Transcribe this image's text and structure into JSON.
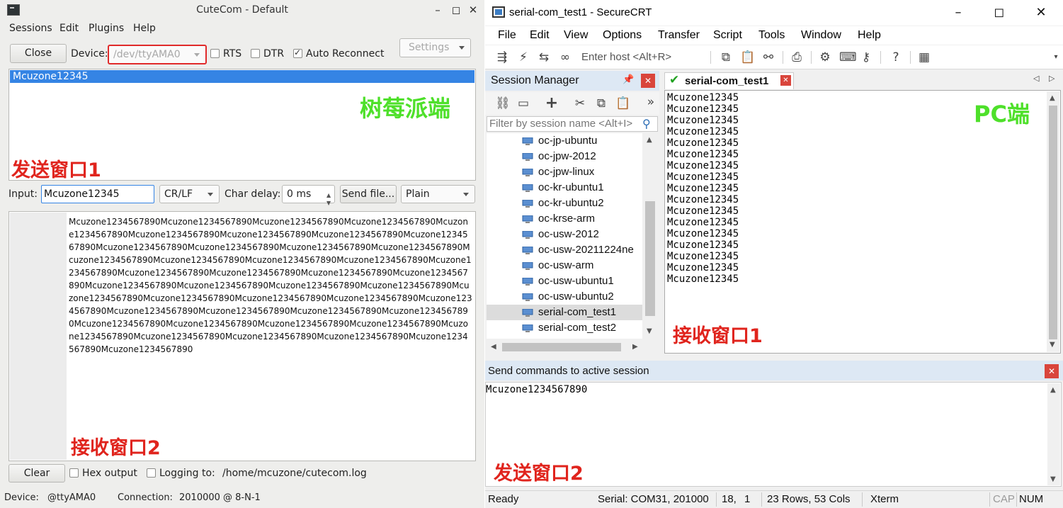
{
  "cutecom": {
    "window_title": "CuteCom - Default",
    "menu": [
      "Sessions",
      "Edit",
      "Plugins",
      "Help"
    ],
    "close_button": "Close",
    "device_label": "Device:",
    "device_value": "/dev/ttyAMA0",
    "rts_label": "RTS",
    "dtr_label": "DTR",
    "auto_reconnect_label": "Auto Reconnect",
    "settings_button": "Settings",
    "sent_history": [
      "Mcuzone12345"
    ],
    "input_label": "Input:",
    "input_value": "Mcuzone12345",
    "line_ending": "CR/LF",
    "char_delay_label": "Char delay:",
    "char_delay_value": "0 ms",
    "send_file_button": "Send file...",
    "format_value": "Plain",
    "received_text": "Mcuzone1234567890Mcuzone1234567890Mcuzone1234567890Mcuzone1234567890Mcuzone1234567890Mcuzone1234567890Mcuzone1234567890Mcuzone1234567890Mcuzone1234567890Mcuzone1234567890Mcuzone1234567890Mcuzone1234567890Mcuzone1234567890Mcuzone1234567890Mcuzone1234567890Mcuzone1234567890Mcuzone1234567890Mcuzone1234567890Mcuzone1234567890Mcuzone1234567890Mcuzone1234567890Mcuzone1234567890Mcuzone1234567890Mcuzone1234567890Mcuzone1234567890Mcuzone1234567890Mcuzone1234567890Mcuzone1234567890Mcuzone1234567890Mcuzone1234567890Mcuzone1234567890Mcuzone1234567890Mcuzone1234567890Mcuzone1234567890Mcuzone1234567890Mcuzone1234567890Mcuzone1234567890Mcuzone1234567890Mcuzone1234567890Mcuzone1234567890Mcuzone1234567890Mcuzone1234567890Mcuzone1234567890Mcuzone1234567890Mcuzone1234567890",
    "clear_button": "Clear",
    "hex_output_label": "Hex output",
    "logging_label": "Logging to:",
    "logging_path": "/home/mcuzone/cutecom.log",
    "status_device_label": "Device:",
    "status_device_value": "@ttyAMA0",
    "status_connection_label": "Connection:",
    "status_connection_value": "2010000 @ 8-N-1",
    "checkbox_states": {
      "rts": false,
      "dtr": false,
      "auto_reconnect": true,
      "hex_output": false,
      "logging": false
    }
  },
  "securecrt": {
    "window_title": "serial-com_test1 - SecureCRT",
    "menu": [
      "File",
      "Edit",
      "View",
      "Options",
      "Transfer",
      "Script",
      "Tools",
      "Window",
      "Help"
    ],
    "host_placeholder": "Enter host <Alt+R>",
    "session_manager_title": "Session Manager",
    "filter_placeholder": "Filter by session name <Alt+I>",
    "sessions": [
      "oc-jp-ubuntu",
      "oc-jpw-2012",
      "oc-jpw-linux",
      "oc-kr-ubuntu1",
      "oc-kr-ubuntu2",
      "oc-krse-arm",
      "oc-usw-2012",
      "oc-usw-20211224ne",
      "oc-usw-arm",
      "oc-usw-ubuntu1",
      "oc-usw-ubuntu2",
      "serial-com_test1",
      "serial-com_test2"
    ],
    "selected_session": "serial-com_test1",
    "tab_label": "serial-com_test1",
    "terminal_lines": [
      "Mcuzone12345",
      "Mcuzone12345",
      "Mcuzone12345",
      "Mcuzone12345",
      "Mcuzone12345",
      "Mcuzone12345",
      "Mcuzone12345",
      "Mcuzone12345",
      "Mcuzone12345",
      "Mcuzone12345",
      "Mcuzone12345",
      "Mcuzone12345",
      "Mcuzone12345",
      "Mcuzone12345",
      "Mcuzone12345",
      "Mcuzone12345",
      "Mcuzone12345"
    ],
    "send_commands_title": "Send commands to active session",
    "command_text": "Mcuzone1234567890",
    "status": {
      "ready": "Ready",
      "serial": "Serial: COM31, 201000",
      "row": "18,",
      "col": "1",
      "size": "23 Rows, 53 Cols",
      "emulation": "Xterm",
      "cap": "CAP",
      "num": "NUM"
    }
  },
  "annotations": {
    "raspberry_side": "树莓派端",
    "pc_side": "PC端",
    "send_window_1": "发送窗口1",
    "send_window_2": "发送窗口2",
    "receive_window_1": "接收窗口1",
    "receive_window_2": "接收窗口2"
  },
  "colors": {
    "annotation_red": "#e0241d",
    "annotation_green": "#4ee02a",
    "selection_blue": "#3584e4",
    "tab_check_green": "#21a121",
    "close_red": "#d9453c"
  }
}
